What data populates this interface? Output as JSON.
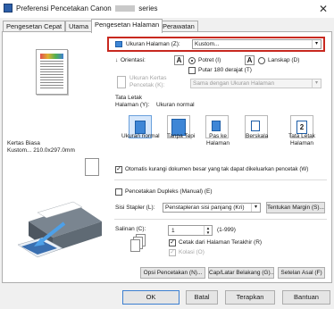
{
  "window": {
    "title": "Preferensi Pencetakan Canon",
    "title_suffix": "series"
  },
  "tabs": [
    {
      "label": "Pengesetan Cepat"
    },
    {
      "label": "Utama"
    },
    {
      "label": "Pengesetan Halaman"
    },
    {
      "label": "Perawatan"
    }
  ],
  "page_size": {
    "label": "Ukuran Halaman (Z):",
    "value": "Kustom..."
  },
  "orientation": {
    "label": "Orientasi:",
    "portrait_label": "Potret (I)",
    "landscape_label": "Lanskap (D)",
    "selected": "portrait",
    "rotate_label": "Putar 180 derajat (T)",
    "rotate_checked": false
  },
  "printer_paper_size": {
    "label": "Ukuran Kertas Pencetak (K):",
    "value": "Sama dengan Ukuran Halaman"
  },
  "page_layout": {
    "label": "Tata Letak Halaman (Y):",
    "current_value": "Ukuran normal",
    "options": [
      {
        "label": "Ukuran normal",
        "icon": "normal-size-icon"
      },
      {
        "label": "Tanpa Tepi",
        "icon": "borderless-icon"
      },
      {
        "label": "Pas ke Halaman",
        "icon": "fit-to-page-icon"
      },
      {
        "label": "Berskala",
        "icon": "scaled-icon"
      },
      {
        "label": "Tata Letak Halaman",
        "icon": "page-layout-icon"
      }
    ],
    "selected_index": 0
  },
  "preview": {
    "paper_type": "Kertas Biasa",
    "paper_size": "Kustom... 210.0x297.0mm"
  },
  "auto_reduce": {
    "label": "Otomatis kurangi dokumen besar yang tak dapat dikeluarkan pencetak (W)",
    "checked": true
  },
  "duplex": {
    "label": "Pencetakan Dupleks (Manual) (E)",
    "checked": false
  },
  "stapling": {
    "label": "Sisi Stapler (L):",
    "value": "Penstapleran sisi panjang (Kri)",
    "margin_button": "Tentukan Margin (S)..."
  },
  "copies": {
    "label": "Salinan (C):",
    "value": "1",
    "range": "(1-999)",
    "last_page_first_label": "Cetak dari Halaman Terakhir (R)",
    "last_page_first_checked": true,
    "collate_label": "Kolasi (O)",
    "collate_checked": true
  },
  "buttons": {
    "print_options": "Opsi Pencetakan (N)...",
    "stamp_background": "Cap/Latar Belakang (G)...",
    "defaults": "Setelan Asal (F)",
    "ok": "OK",
    "cancel": "Batal",
    "apply": "Terapkan",
    "help": "Bantuan"
  },
  "colors": {
    "accent_highlight": "#c8281f",
    "selection_blue": "#d6e7fb",
    "icon_blue": "#3e86d6"
  }
}
